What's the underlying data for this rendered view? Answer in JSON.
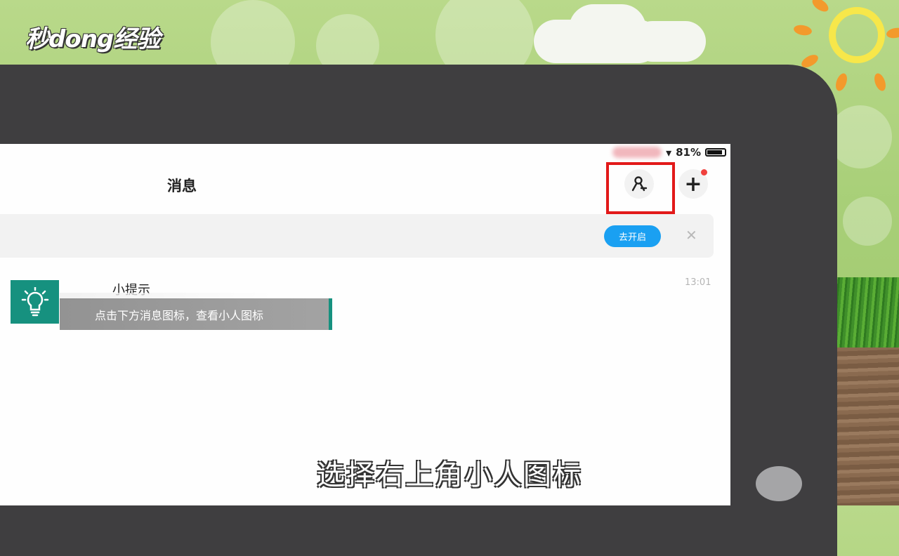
{
  "watermark": {
    "logo_text": "秒dong经验"
  },
  "status_bar": {
    "battery_text": "81%",
    "wifi_icon": "wifi-icon"
  },
  "nav": {
    "title": "消息",
    "contacts_icon": "person-icon",
    "add_icon": "plus-icon"
  },
  "banner": {
    "open_label": "去开启",
    "close_icon": "close-icon"
  },
  "message": {
    "name": "小提示",
    "time": "13:01",
    "icon": "lightbulb-icon"
  },
  "tip_overlay": {
    "text": "点击下方消息图标，查看小人图标"
  },
  "caption": {
    "text": "选择右上角小人图标"
  },
  "colors": {
    "accent": "#1aa0f2",
    "highlight": "#e21919",
    "tip_teal": "#16917f",
    "badge": "#f0413e"
  }
}
